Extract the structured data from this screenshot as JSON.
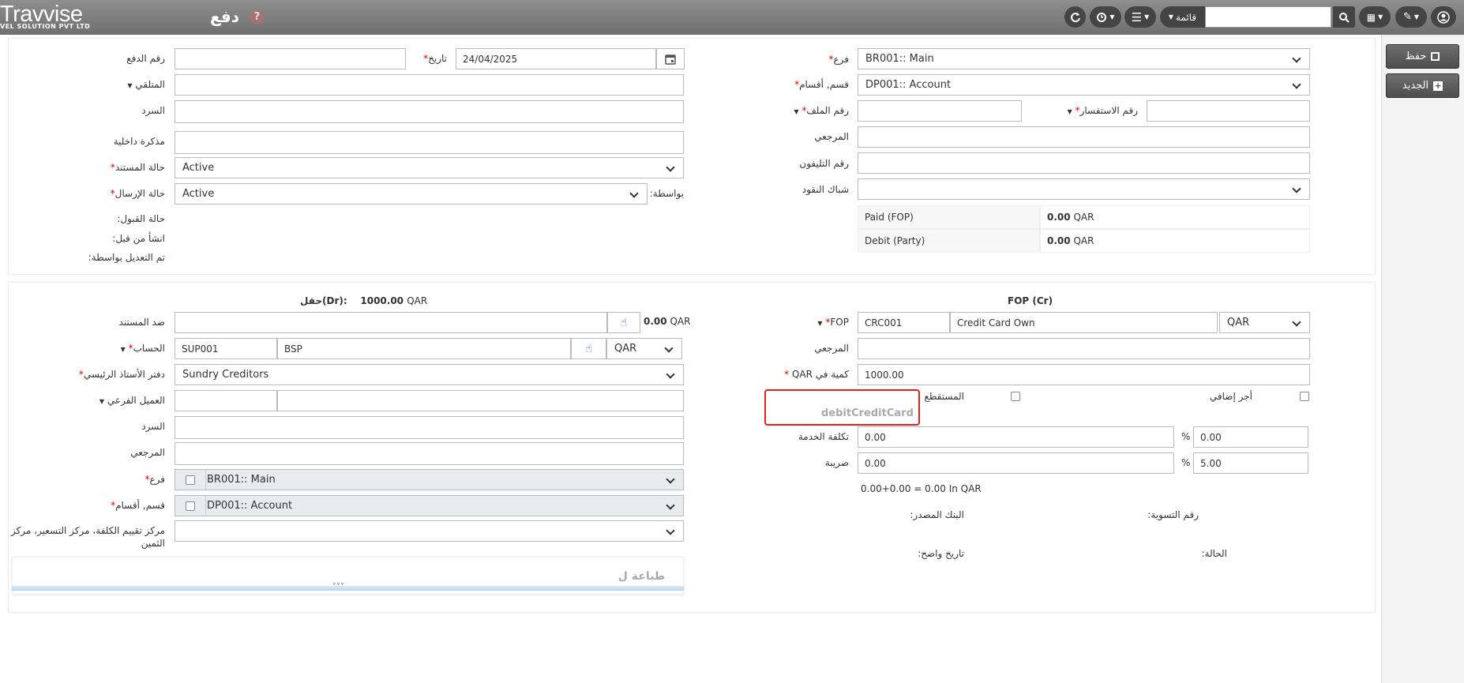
{
  "header": {
    "logo": "Travvise",
    "logo_sub": "VEL SOLUTION PVT LTD",
    "title": "دفع",
    "help": "?",
    "menu_label": "قائمة",
    "search_value": ""
  },
  "sidebar": {
    "save_label": "حفظ",
    "new_label": "الجديد"
  },
  "top_left": {
    "payment_no_label": "رقم الدفع",
    "payment_no_value": "",
    "date_label": "تاريخ",
    "date_value": "24/04/2025",
    "receiver_label": "المتلقي",
    "narration_label": "السرد",
    "internal_memo_label": "مذكرة داخلية",
    "doc_status_label": "حالة المستند",
    "doc_status_value": "Active",
    "send_status_label": "حالة الإرسال",
    "send_status_value": "Active",
    "by_label": "بواسطة:",
    "accept_status_label": "حالة القبول:",
    "created_by_label": "انشأ من قبل:",
    "modified_by_label": "تم التعديل بواسطة:"
  },
  "top_right": {
    "branch_label": "فرع",
    "branch_value": "BR001:: Main",
    "dept_label": "قسم, أقسام",
    "dept_value": "DP001:: Account",
    "file_no_label": "رقم الملف",
    "inquiry_no_label": "رقم الاستفسار",
    "reference_label": "المرجعي",
    "phone_label": "رقم التليفون",
    "cash_counter_label": "شباك النقود",
    "paid_fop_label": "Paid (FOP)",
    "paid_fop_value": "0.00",
    "debit_party_label": "Debit (Party)",
    "debit_party_value": "0.00",
    "currency": "QAR"
  },
  "dr_section": {
    "title_label": "حقل(Dr):",
    "title_amount": "1000.00",
    "currency": "QAR",
    "against_doc_label": "ضد المستند",
    "against_amount": "0.00",
    "account_label": "الحساب",
    "account_code": "SUP001",
    "account_name": "BSP",
    "account_currency": "QAR",
    "ledger_label": "دفتر الأستاذ الرئيسي",
    "ledger_value": "Sundry Creditors",
    "sub_customer_label": "العميل الفرعي",
    "narration_label": "السرد",
    "reference_label": "المرجعي",
    "branch_label": "فرع",
    "branch_value": "BR001:: Main",
    "dept_label": "قسم, أقسام",
    "dept_value": "DP001:: Account",
    "cost_center_label_1": "مركز تقييم الكلفة، مركز التسعير، مركز",
    "cost_center_label_2": "الثمين",
    "print_label": "طباعة ل",
    "expand": "˅˅˅"
  },
  "cr_section": {
    "title": "FOP (Cr)",
    "fop_label": "FOP",
    "fop_code": "CRC001",
    "fop_name": "Credit Card Own",
    "fop_currency": "QAR",
    "reference_label": "المرجعي",
    "amount_label": "كمية في QAR",
    "amount_value": "1000.00",
    "extra_fee_label": "أجر إضافي",
    "deduction_label": "المستقطع",
    "debit_cc": "debitCreditCard",
    "service_cost_label": "تكلفة الخدمة",
    "service_cost_value": "0.00",
    "service_pct": "0.00",
    "tax_label": "ضريبة",
    "tax_value": "0.00",
    "tax_pct": "5.00",
    "pct_sign": "%",
    "formula": "0.00+0.00 = 0.00 In QAR",
    "source_bank_label": "البنك المصدر:",
    "settlement_no_label": "رقم التسوية:",
    "clear_date_label": "تاريخ واضح:",
    "status_label": "الحالة:"
  }
}
